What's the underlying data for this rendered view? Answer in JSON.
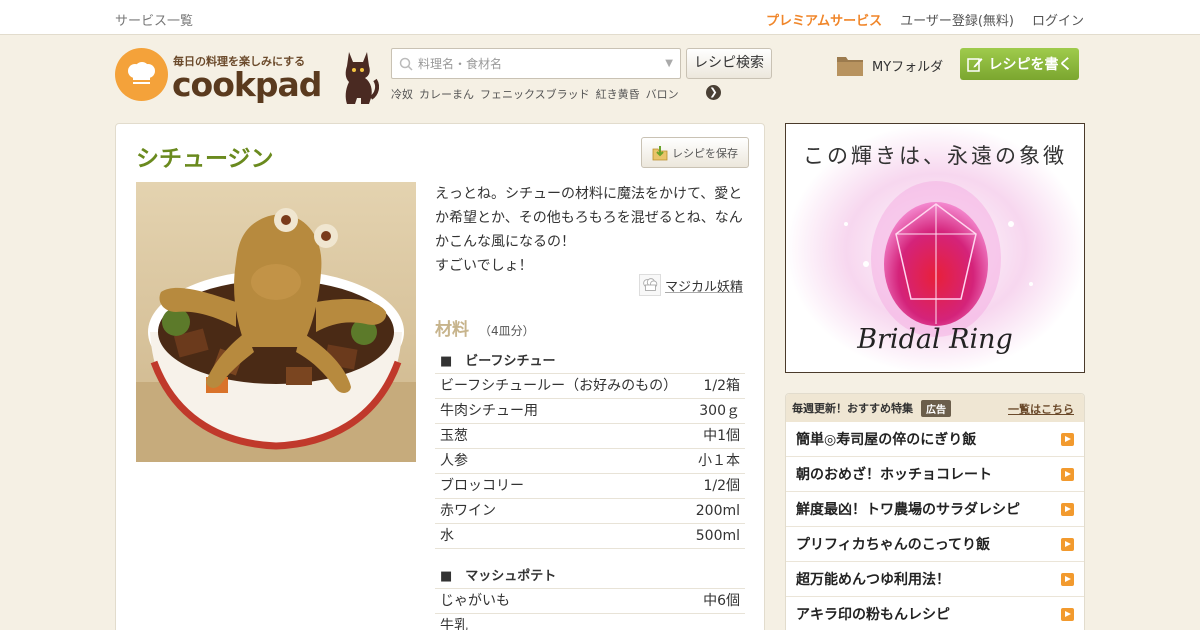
{
  "topbar": {
    "services": "サービス一覧",
    "premium": "プレミアムサービス",
    "register": "ユーザー登録(無料)",
    "login": "ログイン"
  },
  "header": {
    "logo_tagline": "毎日の料理を楽しみにする",
    "logo_word": "cookpad",
    "search_placeholder": "料理名・食材名",
    "search_button": "レシピ検索",
    "keywords": [
      "冷奴",
      "カレーまん",
      "フェニックスブラッド",
      "紅き黄昏",
      "バロン"
    ],
    "myfolder": "MYフォルダ",
    "write_recipe": "レシピを書く"
  },
  "recipe": {
    "title": "シチュージン",
    "save_button": "レシピを保存",
    "description": "えっとね。シチューの材料に魔法をかけて、愛とか希望とか、その他もろもろを混ぜるとね、なんかこんな風になるの！\nすごいでしょ！",
    "author": "マジカル妖精",
    "ingredients_title": "材料",
    "servings": "（4皿分）",
    "sections": [
      {
        "title": "■　ビーフシチュー",
        "items": [
          {
            "name": "ビーフシチュールー（お好みのもの）",
            "qty": "1/2箱"
          },
          {
            "name": "牛肉シチュー用",
            "qty": "300ｇ"
          },
          {
            "name": "玉葱",
            "qty": "中1個"
          },
          {
            "name": "人参",
            "qty": "小１本"
          },
          {
            "name": "ブロッコリー",
            "qty": "1/2個"
          },
          {
            "name": "赤ワイン",
            "qty": "200ml"
          },
          {
            "name": "水",
            "qty": "500ml"
          }
        ]
      },
      {
        "title": "■　マッシュポテト",
        "items": [
          {
            "name": "じゃがいも",
            "qty": "中6個"
          },
          {
            "name": "牛乳",
            "qty": ""
          }
        ]
      }
    ]
  },
  "ad": {
    "headline": "この輝きは、永遠の象徴",
    "script": "Bridal Ring"
  },
  "feature": {
    "header": "毎週更新！おすすめ特集",
    "badge": "広告",
    "more": "一覧はこちら",
    "items": [
      "簡単◎寿司屋の倅のにぎり飯",
      "朝のおめざ！ホッチョコレート",
      "鮮度最凶！トワ農場のサラダレシピ",
      "プリフィカちゃんのこってり飯",
      "超万能めんつゆ利用法！",
      "アキラ印の粉もんレシピ"
    ]
  }
}
